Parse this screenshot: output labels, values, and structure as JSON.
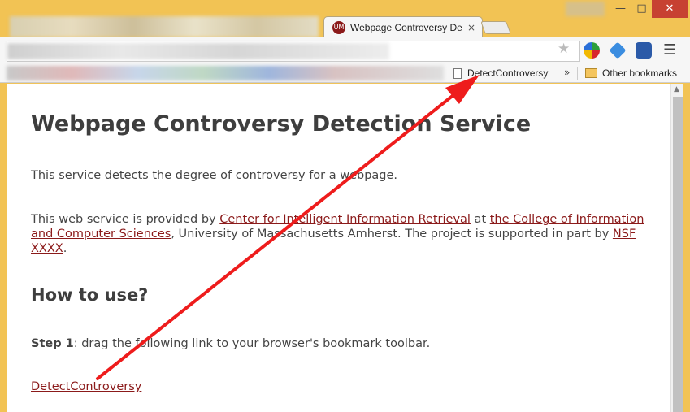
{
  "tab": {
    "title": "Webpage Controversy De",
    "favicon": "UM",
    "close": "×"
  },
  "window": {
    "minimize": "—",
    "maximize": "□",
    "close": "✕"
  },
  "toolbar": {
    "star": "★",
    "menu": "☰"
  },
  "bookmarks": {
    "item": "DetectControversy",
    "overflow": "»",
    "other": "Other bookmarks"
  },
  "page": {
    "title": "Webpage Controversy Detection Service",
    "intro": "This service detects the degree of controversy for a webpage.",
    "provided": {
      "pre": "This web service is provided by ",
      "link1": "Center for Intelligent Information Retrieval",
      "mid1": " at ",
      "link2": "the College of Information and Computer Sciences",
      "mid2": ", University of Massachusetts Amherst. The project is supported in part by ",
      "link3": "NSF XXXX",
      "post": "."
    },
    "how_heading": "How to use?",
    "step1": {
      "label": "Step 1",
      "text": ": drag the following link to your browser's bookmark toolbar."
    },
    "bookmarklet": "DetectControversy"
  },
  "colors": {
    "link": "#8b1a1a",
    "arrow": "#ee1c1c",
    "frame": "#f2c354"
  }
}
